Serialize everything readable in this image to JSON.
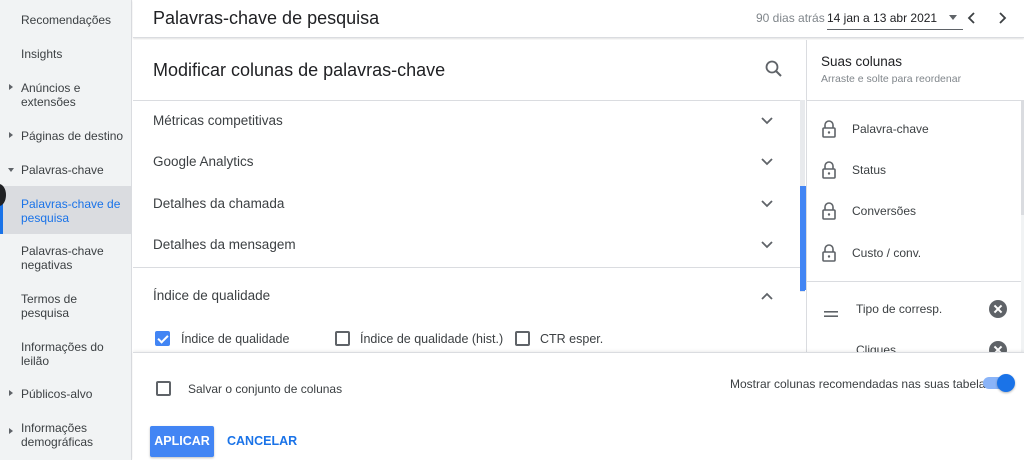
{
  "sidebar": {
    "items": [
      {
        "label": "Recomendações"
      },
      {
        "label": "Insights"
      },
      {
        "label": "Anúncios e extensões"
      },
      {
        "label": "Páginas de destino"
      },
      {
        "label": "Palavras-chave"
      },
      {
        "label": "Palavras-chave de pesquisa"
      },
      {
        "label": "Palavras-chave negativas"
      },
      {
        "label": "Termos de pesquisa"
      },
      {
        "label": "Informações do leilão"
      },
      {
        "label": "Públicos-alvo"
      },
      {
        "label": "Informações demográficas"
      }
    ]
  },
  "header": {
    "title": "Palavras-chave de pesquisa",
    "date_label": "90 dias atrás",
    "date_range": "14 jan a 13 abr 2021",
    "prev_icon": "chevron-left-icon",
    "next_icon": "chevron-right-icon"
  },
  "panel": {
    "title": "Modificar colunas de palavras-chave",
    "search_icon": "search-icon",
    "sections": [
      {
        "label": "Métricas competitivas",
        "expanded": false
      },
      {
        "label": "Google Analytics",
        "expanded": false
      },
      {
        "label": "Detalhes da chamada",
        "expanded": false
      },
      {
        "label": "Detalhes da mensagem",
        "expanded": false
      },
      {
        "label": "Índice de qualidade",
        "expanded": true
      }
    ],
    "quality_options": [
      {
        "label": "Índice de qualidade",
        "checked": true
      },
      {
        "label": "Índice de qualidade (hist.)",
        "checked": false
      },
      {
        "label": "CTR esper.",
        "checked": false
      }
    ]
  },
  "footer": {
    "save_set_label": "Salvar o conjunto de colunas",
    "save_set_checked": false,
    "show_recommended_label": "Mostrar colunas recomendadas nas suas tabelas",
    "show_recommended_on": true,
    "apply_label": "APLICAR",
    "cancel_label": "CANCELAR"
  },
  "right_panel": {
    "title": "Suas colunas",
    "subtitle": "Arraste e solte para reordenar",
    "locked_columns": [
      {
        "label": "Palavra-chave"
      },
      {
        "label": "Status"
      },
      {
        "label": "Conversões"
      },
      {
        "label": "Custo / conv."
      }
    ],
    "movable_columns": [
      {
        "label": "Tipo de corresp."
      },
      {
        "label": "Cliques"
      }
    ]
  },
  "colors": {
    "accent": "#1a73e8",
    "button": "#4285f4",
    "sidebar_bg": "#f1f3f4"
  }
}
